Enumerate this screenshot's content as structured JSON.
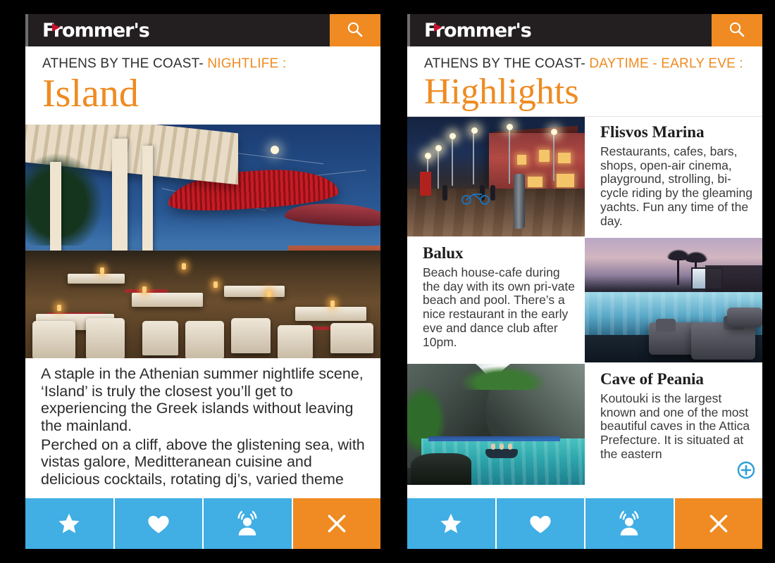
{
  "screens": [
    {
      "id": "nightlife-island",
      "brand": {
        "name": "Frommer's",
        "search_icon": "search-icon"
      },
      "kicker": {
        "prefix": "ATHENS BY THE COAST-",
        "category": "NIGHTLIFE :"
      },
      "title": "Island",
      "hero_image_alt": "Seaside restaurant terrace at dusk with red hammock canopy, candle-lit white tables and sea view",
      "body": [
        "A staple in the Athenian summer nightlife scene, ‘Island’ is truly the closest you’ll get to experiencing the Greek islands without leaving the mainland.",
        "Perched on a cliff, above the glistening sea, with vistas galore, Meditteranean cuisine and delicious cocktails, rotating dj’s, varied theme"
      ]
    },
    {
      "id": "daytime-highlights",
      "brand": {
        "name": "Frommer's",
        "search_icon": "search-icon"
      },
      "kicker": {
        "prefix": "ATHENS BY THE COAST-",
        "category": "DAYTIME - EARLY EVE :"
      },
      "title": "Highlights",
      "cards": [
        {
          "title": "Flisvos Marina",
          "body": "Restaurants, cafes, bars, shops, open-air cinema, playground, strolling, bi-cycle riding by the gleaming yachts.  Fun any time of the day.",
          "image_alt": "Marina promenade at dusk with street lamps, red building and bicycles",
          "image_side": "left"
        },
        {
          "title": "Balux",
          "body": "Beach house-cafe during the day with its own pri-vate beach and pool. There’s a nice restaurant in the early eve and dance club after 10pm.",
          "image_alt": "Beach club swimming pool at dusk with palm trees and lounge sofas",
          "image_side": "right"
        },
        {
          "title": "Cave of Peania",
          "body": "Koutouki is the largest known and one\nof the most beautiful caves in the Attica Prefecture. It is situated at the eastern",
          "image_alt": "Large cave opening above a turquoise lagoon with a small boat",
          "image_side": "left",
          "expand_icon": "plus-circle-icon"
        }
      ]
    }
  ],
  "toolbar": {
    "buttons": [
      {
        "name": "favorite-star-button",
        "icon": "star-icon",
        "label": ""
      },
      {
        "name": "like-heart-button",
        "icon": "heart-icon",
        "label": ""
      },
      {
        "name": "share-person-button",
        "icon": "person-broadcast-icon",
        "label": ""
      },
      {
        "name": "close-button",
        "icon": "close-x-icon",
        "label": ""
      }
    ]
  },
  "colors": {
    "brand_orange": "#ef8b22",
    "toolbar_blue": "#41aee4",
    "topbar_dark": "#231f20",
    "logo_red": "#c8102e",
    "plus_blue": "#2f9fd8",
    "search_strip": "#eef3f7",
    "page_background": "#000000",
    "body_text": "#2b2b2b"
  }
}
